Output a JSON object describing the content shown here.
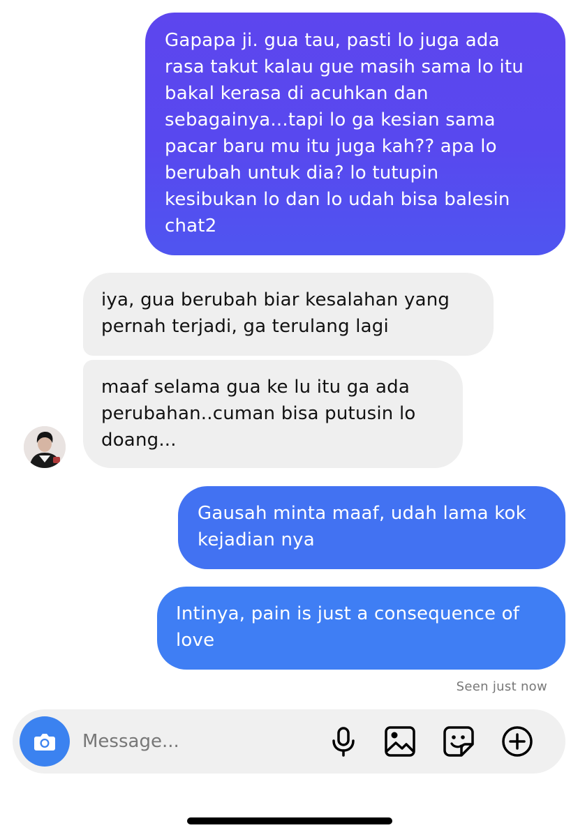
{
  "conversation": {
    "messages": [
      {
        "direction": "sent",
        "text": "Gapapa ji. gua tau, pasti lo juga ada\nrasa takut kalau gue masih sama lo itu\nbakal kerasa di acuhkan dan\nsebagainya...tapi lo ga kesian sama\npacar baru mu itu juga kah?? apa lo\nberubah untuk dia? lo tutupin\nkesibukan lo dan lo udah bisa balesin\nchat2"
      },
      {
        "direction": "received",
        "text": "iya, gua berubah biar kesalahan yang\npernah terjadi, ga terulang lagi"
      },
      {
        "direction": "received",
        "text": "maaf selama gua ke lu itu ga ada\nperubahan..cuman bisa putusin lo\ndoang..."
      },
      {
        "direction": "sent",
        "text": "Gausah minta maaf, udah lama kok\nkejadian nya"
      },
      {
        "direction": "sent",
        "text": "Intinya, pain is just a consequence of\nlove"
      }
    ],
    "seen_status": "Seen just now"
  },
  "composer": {
    "placeholder": "Message...",
    "icons": [
      "camera-icon",
      "microphone-icon",
      "gallery-icon",
      "sticker-icon",
      "plus-icon"
    ]
  },
  "colors": {
    "sent_gradient_top": "#5d46ee",
    "sent_blue": "#3f7ef4",
    "received_bg": "#efefef",
    "camera_button": "#3b82f0"
  }
}
